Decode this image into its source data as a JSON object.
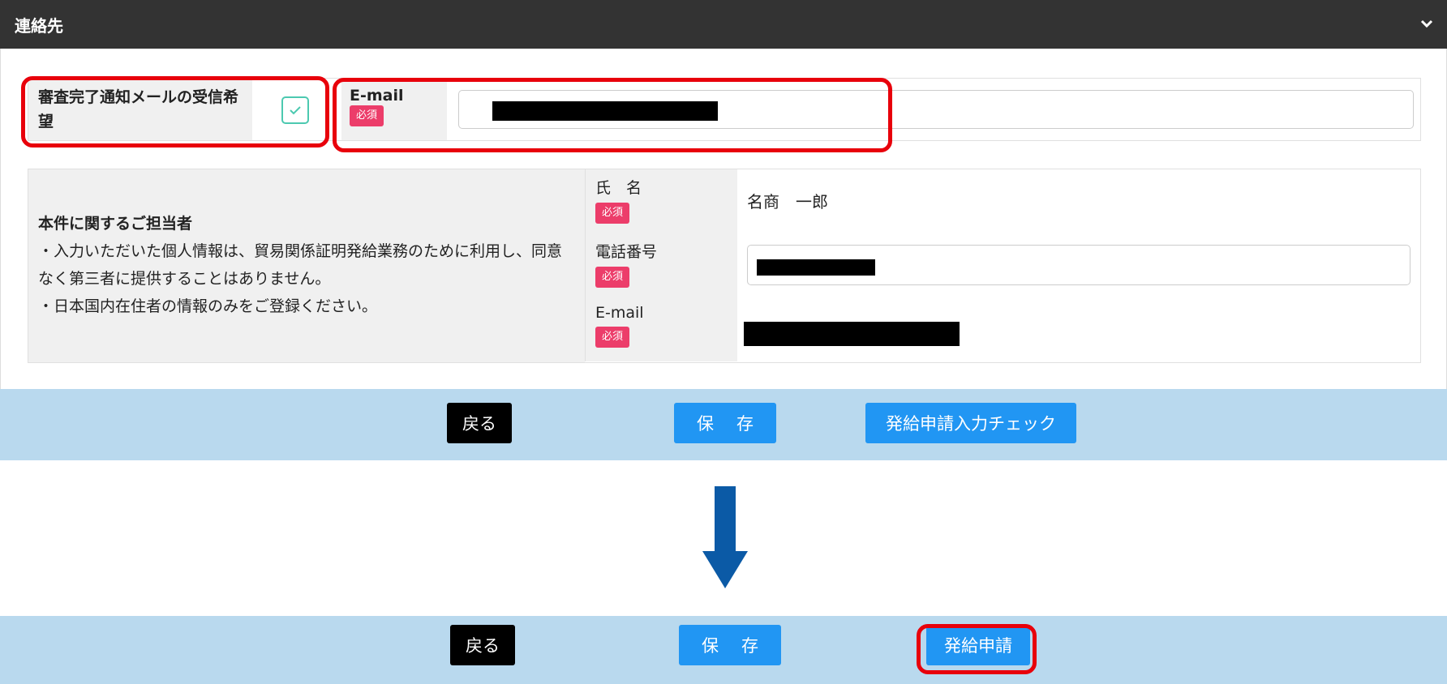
{
  "panel": {
    "title": "連絡先"
  },
  "notify": {
    "label": "審査完了通知メールの受信希望",
    "checked": true,
    "email_label": "E-mail",
    "required_badge": "必須"
  },
  "contact": {
    "heading": "本件に関するご担当者",
    "note1": "・入力いただいた個人情報は、貿易関係証明発給業務のために利用し、同意なく第三者に提供することはありません。",
    "note2": "・日本国内在住者の情報のみをご登録ください。",
    "rows": [
      {
        "label": "氏　名",
        "badge": "必須",
        "value": "名商　一郎"
      },
      {
        "label": "電話番号",
        "badge": "必須",
        "value": ""
      },
      {
        "label": "E-mail",
        "badge": "必須",
        "value": ""
      }
    ]
  },
  "actions_before": {
    "back_label": "戻る",
    "save_label": "保存",
    "check_label": "発給申請入力チェック"
  },
  "actions_after": {
    "back_label": "戻る",
    "save_label": "保存",
    "apply_label": "発給申請"
  },
  "colors": {
    "header_bg": "#333333",
    "badge": "#ec3d6a",
    "primary_button": "#2196f3",
    "action_bar": "#b9d9ee",
    "highlight": "#e8000b",
    "arrow": "#0b5aa6"
  }
}
